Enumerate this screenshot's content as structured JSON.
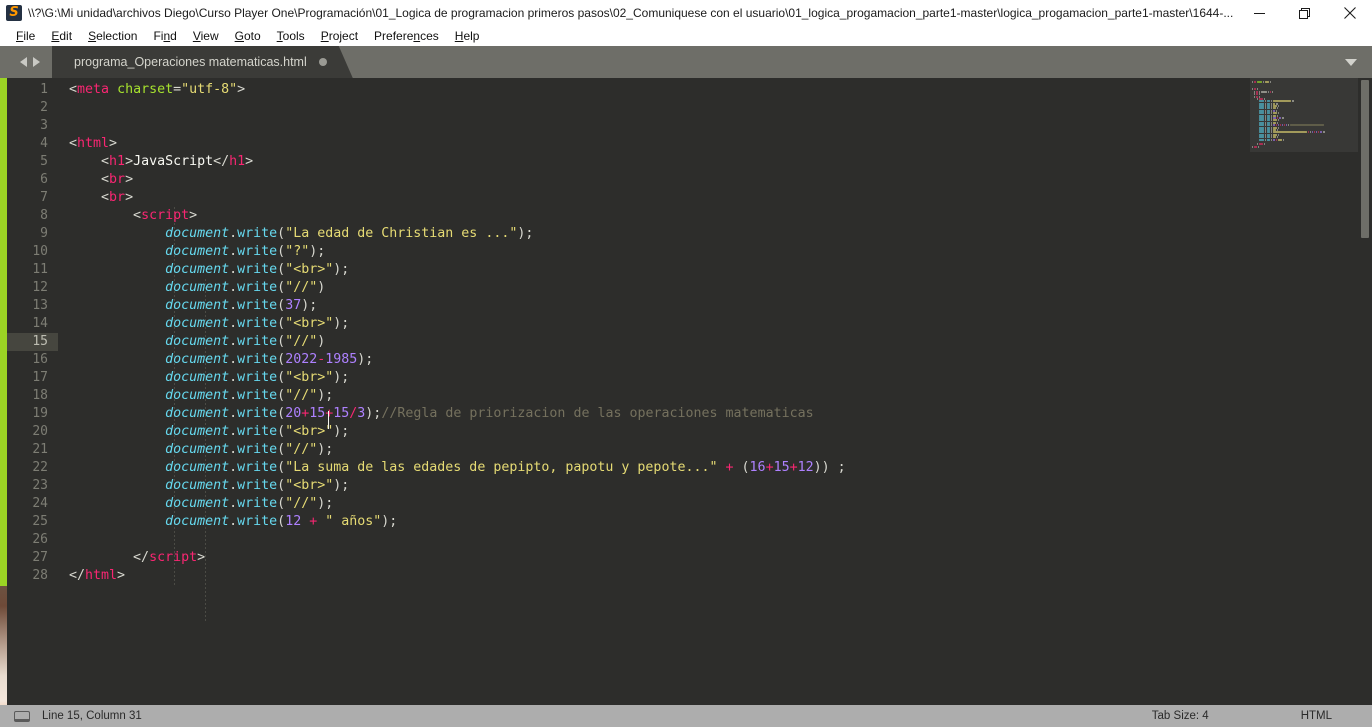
{
  "window": {
    "title": "\\\\?\\G:\\Mi unidad\\archivos Diego\\Curso Player One\\Programación\\01_Logica de programacion primeros pasos\\02_Comuniquese con el usuario\\01_logica_progamacion_parte1-master\\logica_progamacion_parte1-master\\1644-...",
    "app_icon": "sublime-text-icon",
    "minimize_label": "Minimize",
    "maximize_label": "Restore",
    "close_label": "Close"
  },
  "menubar": {
    "items": [
      {
        "label": "File",
        "mnemonic": "F"
      },
      {
        "label": "Edit",
        "mnemonic": "E"
      },
      {
        "label": "Selection",
        "mnemonic": "S"
      },
      {
        "label": "Find",
        "mnemonic": "n"
      },
      {
        "label": "View",
        "mnemonic": "V"
      },
      {
        "label": "Goto",
        "mnemonic": "G"
      },
      {
        "label": "Tools",
        "mnemonic": "T"
      },
      {
        "label": "Project",
        "mnemonic": "P"
      },
      {
        "label": "Preferences",
        "mnemonic": "n"
      },
      {
        "label": "Help",
        "mnemonic": "H"
      }
    ]
  },
  "tabbar": {
    "nav_back_icon": "triangle-left-icon",
    "nav_forward_icon": "triangle-right-icon",
    "dropdown_icon": "chevron-down-icon",
    "tabs": [
      {
        "label": "programa_Operaciones matematicas.html",
        "dirty": true,
        "active": true
      }
    ]
  },
  "editor": {
    "active_line": 15,
    "total_lines": 28,
    "line_numbers": [
      1,
      2,
      3,
      4,
      5,
      6,
      7,
      8,
      9,
      10,
      11,
      12,
      13,
      14,
      15,
      16,
      17,
      18,
      19,
      20,
      21,
      22,
      23,
      24,
      25,
      26,
      27,
      28
    ],
    "lines": [
      {
        "n": 1,
        "tokens": [
          {
            "t": "punc",
            "v": "<"
          },
          {
            "t": "tag",
            "v": "meta"
          },
          {
            "t": "plain",
            "v": " "
          },
          {
            "t": "attr",
            "v": "charset"
          },
          {
            "t": "punc",
            "v": "="
          },
          {
            "t": "str",
            "v": "\"utf-8\""
          },
          {
            "t": "punc",
            "v": ">"
          }
        ]
      },
      {
        "n": 2,
        "tokens": []
      },
      {
        "n": 3,
        "tokens": []
      },
      {
        "n": 4,
        "tokens": [
          {
            "t": "punc",
            "v": "<"
          },
          {
            "t": "tag",
            "v": "html"
          },
          {
            "t": "punc",
            "v": ">"
          }
        ]
      },
      {
        "n": 5,
        "tokens": [
          {
            "t": "plain",
            "v": "    "
          },
          {
            "t": "punc",
            "v": "<"
          },
          {
            "t": "tag",
            "v": "h1"
          },
          {
            "t": "punc",
            "v": ">"
          },
          {
            "t": "plain",
            "v": "JavaScript"
          },
          {
            "t": "punc",
            "v": "</"
          },
          {
            "t": "tag",
            "v": "h1"
          },
          {
            "t": "punc",
            "v": ">"
          }
        ]
      },
      {
        "n": 6,
        "tokens": [
          {
            "t": "plain",
            "v": "    "
          },
          {
            "t": "punc",
            "v": "<"
          },
          {
            "t": "tag",
            "v": "br"
          },
          {
            "t": "punc",
            "v": ">"
          }
        ]
      },
      {
        "n": 7,
        "tokens": [
          {
            "t": "plain",
            "v": "    "
          },
          {
            "t": "punc",
            "v": "<"
          },
          {
            "t": "tag",
            "v": "br"
          },
          {
            "t": "punc",
            "v": ">"
          }
        ]
      },
      {
        "n": 8,
        "tokens": [
          {
            "t": "plain",
            "v": "        "
          },
          {
            "t": "punc",
            "v": "<"
          },
          {
            "t": "tag",
            "v": "script"
          },
          {
            "t": "punc",
            "v": ">"
          }
        ]
      },
      {
        "n": 9,
        "tokens": [
          {
            "t": "plain",
            "v": "            "
          },
          {
            "t": "var",
            "v": "document"
          },
          {
            "t": "punc",
            "v": "."
          },
          {
            "t": "fn",
            "v": "write"
          },
          {
            "t": "punc",
            "v": "("
          },
          {
            "t": "str",
            "v": "\"La edad de Christian es ...\""
          },
          {
            "t": "punc",
            "v": ");"
          }
        ]
      },
      {
        "n": 10,
        "tokens": [
          {
            "t": "plain",
            "v": "            "
          },
          {
            "t": "var",
            "v": "document"
          },
          {
            "t": "punc",
            "v": "."
          },
          {
            "t": "fn",
            "v": "write"
          },
          {
            "t": "punc",
            "v": "("
          },
          {
            "t": "str",
            "v": "\"?\""
          },
          {
            "t": "punc",
            "v": ");"
          }
        ]
      },
      {
        "n": 11,
        "tokens": [
          {
            "t": "plain",
            "v": "            "
          },
          {
            "t": "var",
            "v": "document"
          },
          {
            "t": "punc",
            "v": "."
          },
          {
            "t": "fn",
            "v": "write"
          },
          {
            "t": "punc",
            "v": "("
          },
          {
            "t": "str",
            "v": "\"<br>\""
          },
          {
            "t": "punc",
            "v": ");"
          }
        ]
      },
      {
        "n": 12,
        "tokens": [
          {
            "t": "plain",
            "v": "            "
          },
          {
            "t": "var",
            "v": "document"
          },
          {
            "t": "punc",
            "v": "."
          },
          {
            "t": "fn",
            "v": "write"
          },
          {
            "t": "punc",
            "v": "("
          },
          {
            "t": "str",
            "v": "\"//\""
          },
          {
            "t": "punc",
            "v": ")"
          }
        ]
      },
      {
        "n": 13,
        "tokens": [
          {
            "t": "plain",
            "v": "            "
          },
          {
            "t": "var",
            "v": "document"
          },
          {
            "t": "punc",
            "v": "."
          },
          {
            "t": "fn",
            "v": "write"
          },
          {
            "t": "punc",
            "v": "("
          },
          {
            "t": "num",
            "v": "37"
          },
          {
            "t": "punc",
            "v": ");"
          }
        ]
      },
      {
        "n": 14,
        "tokens": [
          {
            "t": "plain",
            "v": "            "
          },
          {
            "t": "var",
            "v": "document"
          },
          {
            "t": "punc",
            "v": "."
          },
          {
            "t": "fn",
            "v": "write"
          },
          {
            "t": "punc",
            "v": "("
          },
          {
            "t": "str",
            "v": "\"<br>\""
          },
          {
            "t": "punc",
            "v": ");"
          }
        ]
      },
      {
        "n": 15,
        "tokens": [
          {
            "t": "plain",
            "v": "            "
          },
          {
            "t": "var",
            "v": "document"
          },
          {
            "t": "punc",
            "v": "."
          },
          {
            "t": "fn",
            "v": "write"
          },
          {
            "t": "punc",
            "v": "("
          },
          {
            "t": "str",
            "v": "\"//\""
          },
          {
            "t": "punc",
            "v": ")"
          }
        ]
      },
      {
        "n": 16,
        "tokens": [
          {
            "t": "plain",
            "v": "            "
          },
          {
            "t": "var",
            "v": "document"
          },
          {
            "t": "punc",
            "v": "."
          },
          {
            "t": "fn",
            "v": "write"
          },
          {
            "t": "punc",
            "v": "("
          },
          {
            "t": "num",
            "v": "2022"
          },
          {
            "t": "op",
            "v": "-"
          },
          {
            "t": "num",
            "v": "1985"
          },
          {
            "t": "punc",
            "v": ");"
          }
        ]
      },
      {
        "n": 17,
        "tokens": [
          {
            "t": "plain",
            "v": "            "
          },
          {
            "t": "var",
            "v": "document"
          },
          {
            "t": "punc",
            "v": "."
          },
          {
            "t": "fn",
            "v": "write"
          },
          {
            "t": "punc",
            "v": "("
          },
          {
            "t": "str",
            "v": "\"<br>\""
          },
          {
            "t": "punc",
            "v": ");"
          }
        ]
      },
      {
        "n": 18,
        "tokens": [
          {
            "t": "plain",
            "v": "            "
          },
          {
            "t": "var",
            "v": "document"
          },
          {
            "t": "punc",
            "v": "."
          },
          {
            "t": "fn",
            "v": "write"
          },
          {
            "t": "punc",
            "v": "("
          },
          {
            "t": "str",
            "v": "\"//\""
          },
          {
            "t": "punc",
            "v": ");"
          }
        ]
      },
      {
        "n": 19,
        "tokens": [
          {
            "t": "plain",
            "v": "            "
          },
          {
            "t": "var",
            "v": "document"
          },
          {
            "t": "punc",
            "v": "."
          },
          {
            "t": "fn",
            "v": "write"
          },
          {
            "t": "punc",
            "v": "("
          },
          {
            "t": "num",
            "v": "20"
          },
          {
            "t": "op",
            "v": "+"
          },
          {
            "t": "num",
            "v": "15"
          },
          {
            "t": "op",
            "v": "+"
          },
          {
            "t": "num",
            "v": "15"
          },
          {
            "t": "op",
            "v": "/"
          },
          {
            "t": "num",
            "v": "3"
          },
          {
            "t": "punc",
            "v": ");"
          },
          {
            "t": "comment",
            "v": "//Regla de priorizacion de las operaciones matematicas"
          }
        ]
      },
      {
        "n": 20,
        "tokens": [
          {
            "t": "plain",
            "v": "            "
          },
          {
            "t": "var",
            "v": "document"
          },
          {
            "t": "punc",
            "v": "."
          },
          {
            "t": "fn",
            "v": "write"
          },
          {
            "t": "punc",
            "v": "("
          },
          {
            "t": "str",
            "v": "\"<br>\""
          },
          {
            "t": "punc",
            "v": ");"
          }
        ]
      },
      {
        "n": 21,
        "tokens": [
          {
            "t": "plain",
            "v": "            "
          },
          {
            "t": "var",
            "v": "document"
          },
          {
            "t": "punc",
            "v": "."
          },
          {
            "t": "fn",
            "v": "write"
          },
          {
            "t": "punc",
            "v": "("
          },
          {
            "t": "str",
            "v": "\"//\""
          },
          {
            "t": "punc",
            "v": ");"
          }
        ]
      },
      {
        "n": 22,
        "tokens": [
          {
            "t": "plain",
            "v": "            "
          },
          {
            "t": "var",
            "v": "document"
          },
          {
            "t": "punc",
            "v": "."
          },
          {
            "t": "fn",
            "v": "write"
          },
          {
            "t": "punc",
            "v": "("
          },
          {
            "t": "str",
            "v": "\"La suma de las edades de pepipto, papotu y pepote...\""
          },
          {
            "t": "plain",
            "v": " "
          },
          {
            "t": "op",
            "v": "+"
          },
          {
            "t": "plain",
            "v": " "
          },
          {
            "t": "punc",
            "v": "("
          },
          {
            "t": "num",
            "v": "16"
          },
          {
            "t": "op",
            "v": "+"
          },
          {
            "t": "num",
            "v": "15"
          },
          {
            "t": "op",
            "v": "+"
          },
          {
            "t": "num",
            "v": "12"
          },
          {
            "t": "punc",
            "v": ")) ;"
          }
        ]
      },
      {
        "n": 23,
        "tokens": [
          {
            "t": "plain",
            "v": "            "
          },
          {
            "t": "var",
            "v": "document"
          },
          {
            "t": "punc",
            "v": "."
          },
          {
            "t": "fn",
            "v": "write"
          },
          {
            "t": "punc",
            "v": "("
          },
          {
            "t": "str",
            "v": "\"<br>\""
          },
          {
            "t": "punc",
            "v": ");"
          }
        ]
      },
      {
        "n": 24,
        "tokens": [
          {
            "t": "plain",
            "v": "            "
          },
          {
            "t": "var",
            "v": "document"
          },
          {
            "t": "punc",
            "v": "."
          },
          {
            "t": "fn",
            "v": "write"
          },
          {
            "t": "punc",
            "v": "("
          },
          {
            "t": "str",
            "v": "\"//\""
          },
          {
            "t": "punc",
            "v": ");"
          }
        ]
      },
      {
        "n": 25,
        "tokens": [
          {
            "t": "plain",
            "v": "            "
          },
          {
            "t": "var",
            "v": "document"
          },
          {
            "t": "punc",
            "v": "."
          },
          {
            "t": "fn",
            "v": "write"
          },
          {
            "t": "punc",
            "v": "("
          },
          {
            "t": "num",
            "v": "12"
          },
          {
            "t": "plain",
            "v": " "
          },
          {
            "t": "op",
            "v": "+"
          },
          {
            "t": "plain",
            "v": " "
          },
          {
            "t": "str",
            "v": "\" años\""
          },
          {
            "t": "punc",
            "v": ");"
          }
        ]
      },
      {
        "n": 26,
        "tokens": []
      },
      {
        "n": 27,
        "tokens": [
          {
            "t": "plain",
            "v": "        "
          },
          {
            "t": "punc",
            "v": "</"
          },
          {
            "t": "tag",
            "v": "script"
          },
          {
            "t": "punc",
            "v": ">"
          }
        ]
      },
      {
        "n": 28,
        "tokens": [
          {
            "t": "punc",
            "v": "</"
          },
          {
            "t": "tag",
            "v": "html"
          },
          {
            "t": "punc",
            "v": ">"
          }
        ]
      }
    ]
  },
  "statusbar": {
    "encoding_icon": "panel-toggle-icon",
    "position": "Line 15, Column 31",
    "tab_size": "Tab Size: 4",
    "syntax": "HTML"
  },
  "colors": {
    "accent_green": "#9bd424",
    "editor_bg": "#2d2d2b",
    "tag": "#f92672",
    "string": "#e6db74",
    "number": "#ae81ff",
    "variable": "#66d9ef",
    "attribute": "#a6e22e",
    "comment": "#75715e",
    "statusbar_bg": "#adadad",
    "tabbar_bg": "#6e6e68"
  }
}
